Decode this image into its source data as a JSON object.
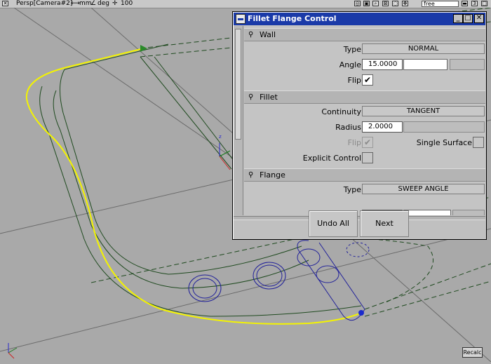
{
  "viewport": {
    "camera_label": "Persp[Camera#2]",
    "units_length": "mm",
    "units_angle": "deg",
    "scale": "100",
    "mode_field": "free",
    "top_right_num": "3",
    "recalc_label": "Recalc",
    "colors": {
      "background": "#a9a9a9",
      "curve_yellow": "#f4f400",
      "wire_green": "#1f4a1f",
      "circles_blue": "#22229a"
    }
  },
  "window": {
    "title": "Fillet Flange Control",
    "controls": {
      "minimize": "_",
      "maximize": "□",
      "close": "✕"
    },
    "sections": {
      "wall": {
        "title": "Wall",
        "type_label": "Type",
        "type_value": "NORMAL",
        "angle_label": "Angle",
        "angle_value": "15.0000",
        "flip_label": "Flip",
        "flip_checked": true
      },
      "fillet": {
        "title": "Fillet",
        "continuity_label": "Continuity",
        "continuity_value": "TANGENT",
        "radius_label": "Radius",
        "radius_value": "2.0000",
        "flip_label": "Flip",
        "flip_checked": true,
        "single_surface_label": "Single Surface",
        "explicit_control_label": "Explicit Control"
      },
      "flange": {
        "title": "Flange",
        "type_label": "Type",
        "type_value": "SWEEP ANGLE"
      }
    },
    "buttons": {
      "undo_all": "Undo All",
      "next": "Next"
    },
    "colors": {
      "titlebar": "#1a3aa8",
      "body": "#c0c0c0"
    }
  }
}
